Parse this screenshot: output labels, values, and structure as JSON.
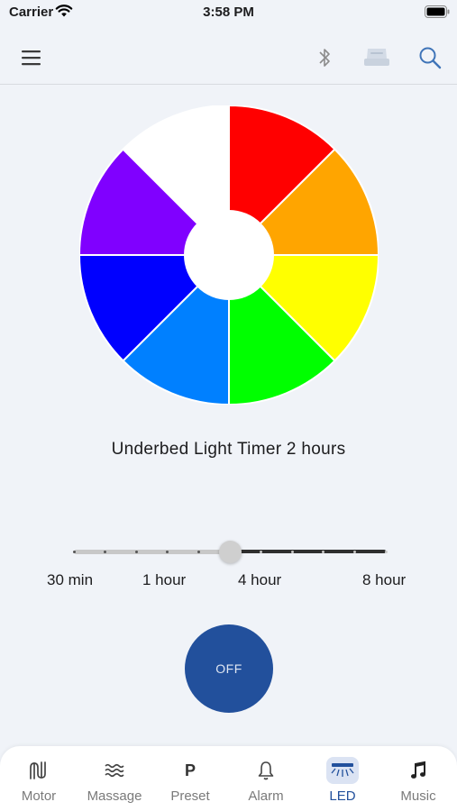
{
  "status_bar": {
    "carrier": "Carrier",
    "time": "3:58 PM"
  },
  "nav": {
    "menu_icon": "hamburger-menu-icon",
    "bluetooth_icon": "bluetooth-icon",
    "bed_icon": "bed-icon",
    "search_icon": "search-icon"
  },
  "color_wheel": {
    "segments": [
      "#ff0000",
      "#ffa500",
      "#ffff00",
      "#00ff00",
      "#0080ff",
      "#0000ff",
      "#8000ff",
      "#ffffff"
    ]
  },
  "timer": {
    "label": "Underbed Light Timer 2 hours"
  },
  "slider": {
    "labels": [
      "30 min",
      "1 hour",
      "4 hour",
      "8 hour"
    ],
    "value_fraction": 0.5
  },
  "power_button": {
    "label": "OFF",
    "color": "#22509c"
  },
  "tabs": [
    {
      "label": "Motor",
      "icon": "motor-icon"
    },
    {
      "label": "Massage",
      "icon": "massage-waves-icon"
    },
    {
      "label": "Preset",
      "icon": "preset-p-icon",
      "glyph": "P"
    },
    {
      "label": "Alarm",
      "icon": "alarm-bell-icon"
    },
    {
      "label": "LED",
      "icon": "led-light-icon",
      "active": true
    },
    {
      "label": "Music",
      "icon": "music-note-icon"
    }
  ],
  "accent_color": "#22509c"
}
